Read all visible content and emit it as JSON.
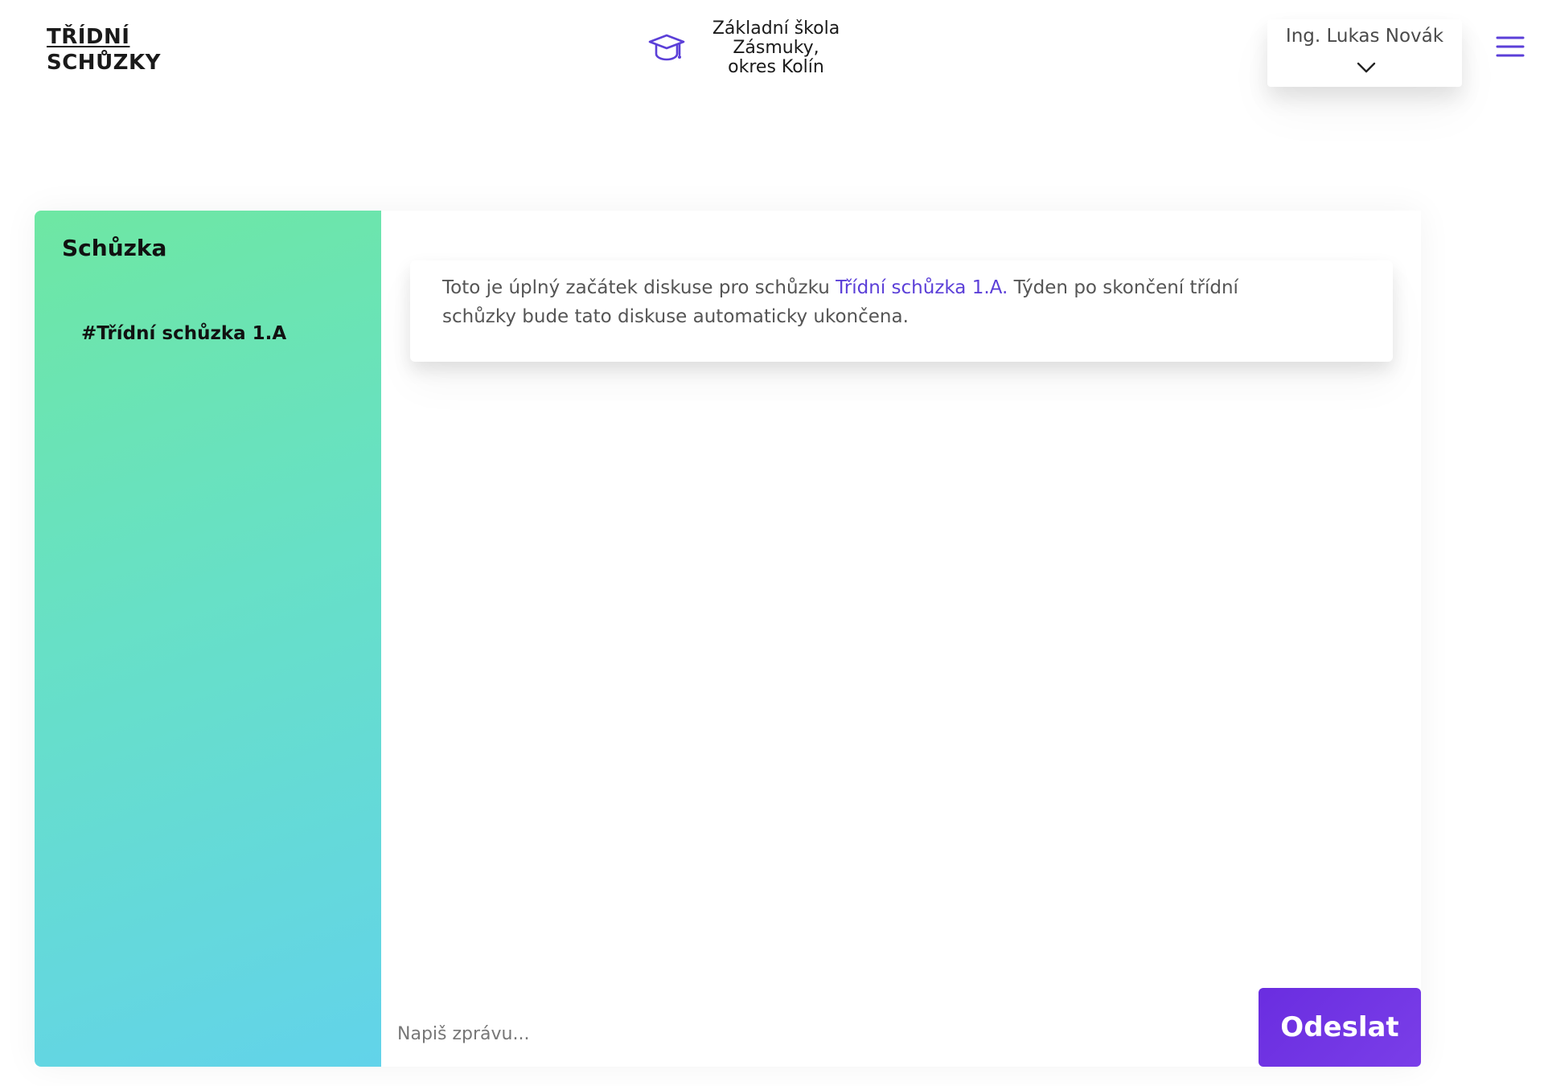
{
  "header": {
    "logo_line1": "TŘÍDNÍ",
    "logo_line2": "SCHŮZKY",
    "school_icon": "graduation-cap-icon",
    "school_name": "Základní škola Zásmuky, okres Kolín",
    "user_name": "Ing. Lukas Novák",
    "user_menu_icon": "chevron-down-icon",
    "menu_icon": "hamburger-menu-icon"
  },
  "sidebar": {
    "title": "Schůzka",
    "channels": [
      {
        "label": "#Třídní schůzka 1.A"
      }
    ]
  },
  "conversation": {
    "intro_prefix": "Toto je úplný začátek diskuse pro schůzku ",
    "intro_link": "Třídní schůzka 1.A.",
    "intro_suffix": " Týden po skončení třídní schůzky bude tato diskuse automaticky ukončena."
  },
  "composer": {
    "placeholder": "Napiš zprávu...",
    "value": "",
    "send_label": "Odeslat"
  },
  "colors": {
    "accent": "#6a2de0",
    "link": "#5b3fd8",
    "sidebar_gradient_start": "#6ee7a3",
    "sidebar_gradient_end": "#62d3ea"
  }
}
